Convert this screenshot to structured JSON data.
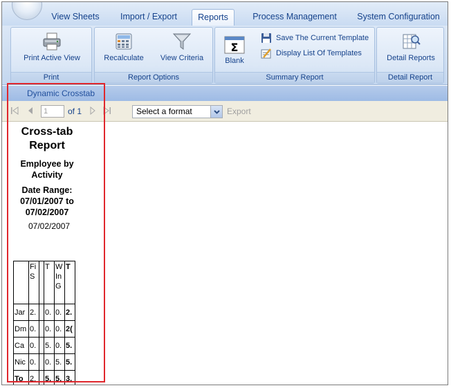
{
  "tabs": [
    {
      "label": "View Sheets",
      "active": false
    },
    {
      "label": "Import / Export",
      "active": false
    },
    {
      "label": "Reports",
      "active": true
    },
    {
      "label": "Process Management",
      "active": false
    },
    {
      "label": "System Configuration",
      "active": false
    }
  ],
  "ribbon": {
    "print_group": {
      "label": "Print",
      "print_active_view": "Print Active View"
    },
    "report_options": {
      "label": "Report Options",
      "recalculate": "Recalculate",
      "view_criteria": "View Criteria"
    },
    "summary_report": {
      "label": "Summary Report",
      "blank": "Blank",
      "save_template": "Save The Current Template",
      "display_templates": "Display List Of Templates"
    },
    "detail_report": {
      "label": "Detail Report",
      "detail_reports": "Detail Reports"
    }
  },
  "document_title": "Dynamic Crosstab",
  "viewer": {
    "page_value": "1",
    "of_text": "of 1",
    "format_selected": "Select a format",
    "export_label": "Export"
  },
  "report": {
    "title_line1": "Cross-tab",
    "title_line2": "Report",
    "subtitle_line1": "Employee by",
    "subtitle_line2": "Activity",
    "range_line1": "Date Range:",
    "range_line2": "07/01/2007 to",
    "range_line3": "07/02/2007",
    "run_date": "07/02/2007"
  },
  "crosstab": {
    "headers": [
      "",
      "Fi S",
      "",
      "T",
      "W In G",
      "T"
    ],
    "rows": [
      [
        "Jar",
        "2.",
        "",
        "0.",
        "0.",
        "2."
      ],
      [
        "Dm",
        "0.",
        "",
        "0.",
        "0.",
        "2("
      ],
      [
        "Ca",
        "0.",
        "",
        "5.",
        "0.",
        "5."
      ],
      [
        "Nic",
        "0.",
        "",
        "0.",
        "5.",
        "5."
      ],
      [
        "To",
        "2.",
        "",
        "5.",
        "5.",
        "3."
      ]
    ]
  },
  "colors": {
    "accent": "#15428b",
    "highlight": "#e0262c",
    "ribbon_bg": "#dbe7f6"
  }
}
